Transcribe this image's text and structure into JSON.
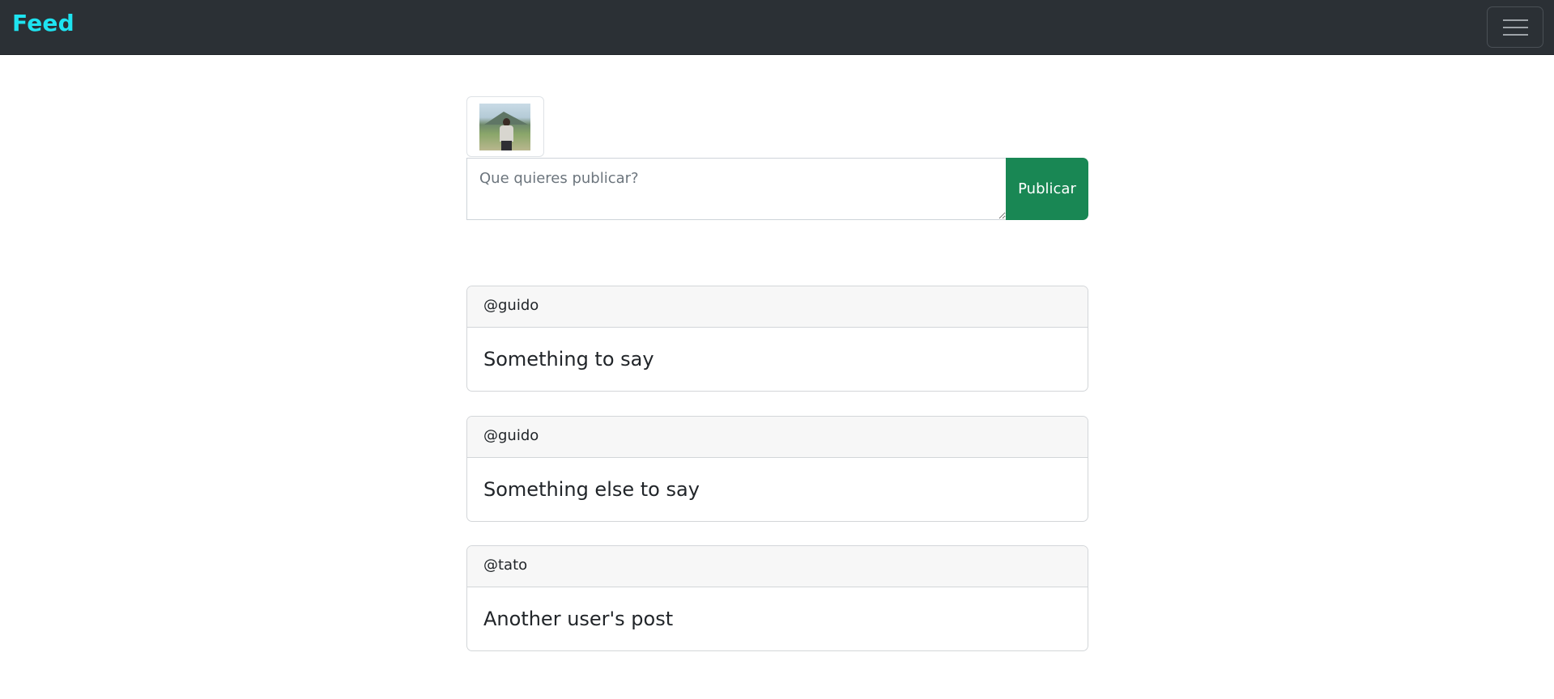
{
  "navbar": {
    "brand": "Feed",
    "toggler_icon": "hamburger-menu-icon"
  },
  "composer": {
    "avatar_image": "profile-photo",
    "placeholder": "Que quieres publicar?",
    "value": "",
    "publish_label": "Publicar"
  },
  "colors": {
    "navbar_bg": "#2b3035",
    "brand": "#1ee3f0",
    "publish_button": "#198754"
  },
  "posts": [
    {
      "username": "@guido",
      "content": "Something to say"
    },
    {
      "username": "@guido",
      "content": "Something else to say"
    },
    {
      "username": "@tato",
      "content": "Another user's post"
    }
  ]
}
